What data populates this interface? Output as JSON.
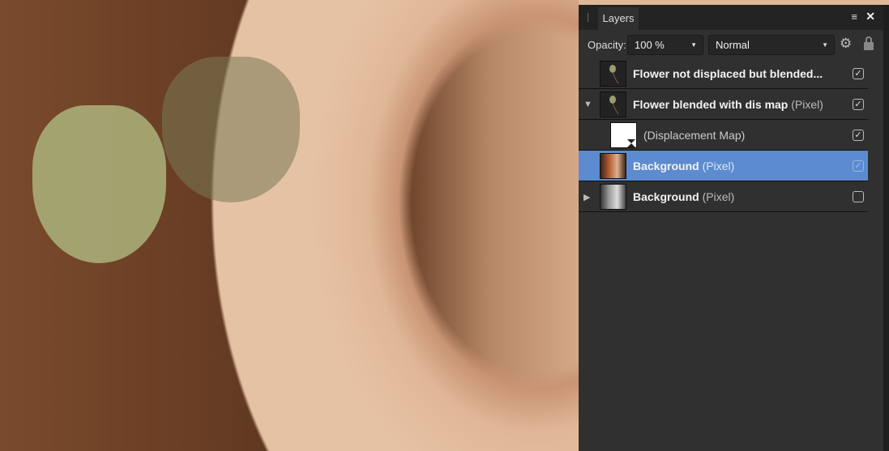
{
  "panel": {
    "tab": "Layers",
    "opacity_label": "Opacity:",
    "opacity_value": "100 %",
    "blend_mode": "Normal"
  },
  "layers": [
    {
      "name": "Flower not displaced but blended...",
      "type": "",
      "visible": true
    },
    {
      "name": "Flower blended with dis map",
      "type": "(Pixel)",
      "visible": true,
      "expanded": true
    },
    {
      "name": "",
      "type": "(Displacement Map)",
      "visible": true
    },
    {
      "name": "Background",
      "type": "(Pixel)",
      "visible": true,
      "selected": true
    },
    {
      "name": "Background",
      "type": "(Pixel)",
      "visible": false,
      "collapsed": true
    }
  ],
  "colors": {
    "selection": "#5c8bd0",
    "panel": "#303030"
  }
}
